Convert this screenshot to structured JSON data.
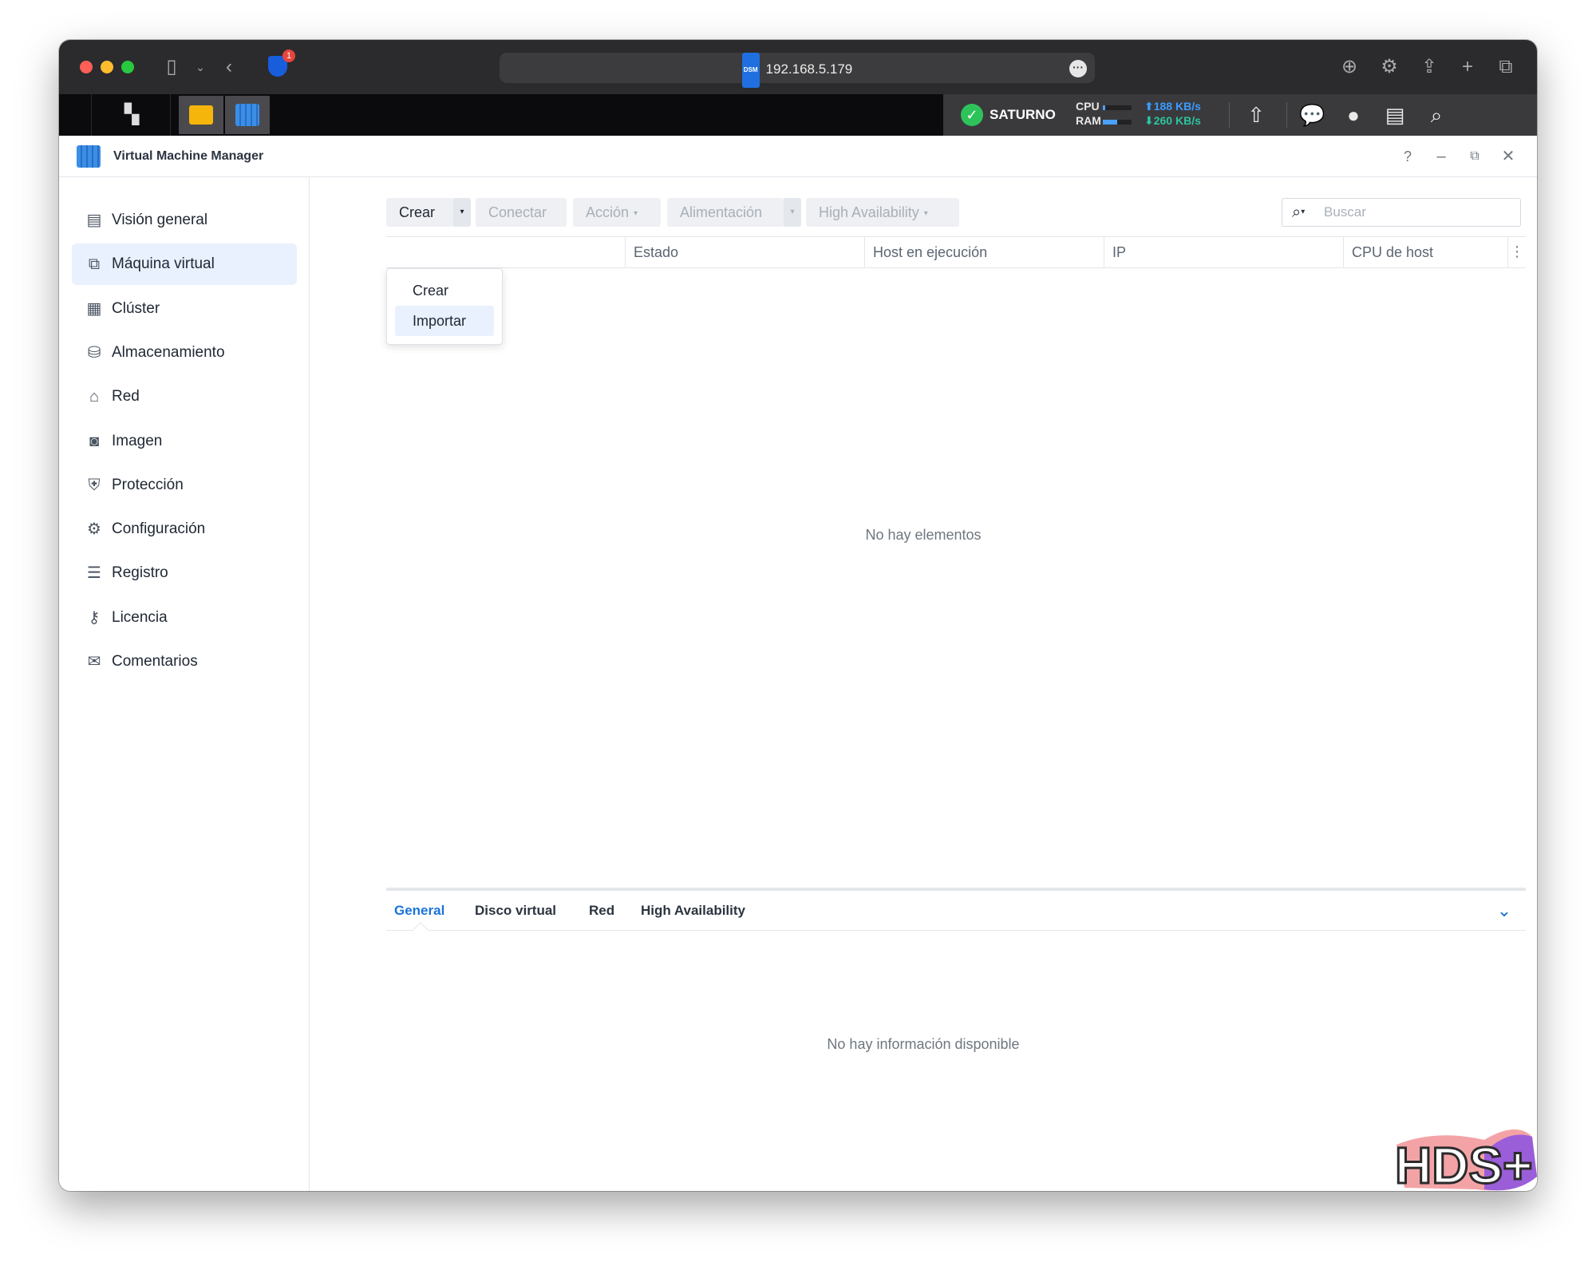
{
  "browser": {
    "url": "192.168.5.179",
    "extension_badge": "1",
    "url_badge": "DSM"
  },
  "dsm_status": {
    "server_name": "SATURNO",
    "cpu_label": "CPU",
    "ram_label": "RAM",
    "upload": "188 KB/s",
    "download": "260 KB/s",
    "cpu_level": 0.08,
    "ram_level": 0.5
  },
  "app": {
    "title": "Virtual Machine Manager",
    "help": "?"
  },
  "sidebar": {
    "items": [
      {
        "label": "Visión general",
        "icon": "overview-icon",
        "glyph": "▤"
      },
      {
        "label": "Máquina virtual",
        "icon": "virtual-machine-icon",
        "glyph": "⧉"
      },
      {
        "label": "Clúster",
        "icon": "cluster-icon",
        "glyph": "▦"
      },
      {
        "label": "Almacenamiento",
        "icon": "storage-icon",
        "glyph": "⛁"
      },
      {
        "label": "Red",
        "icon": "network-icon",
        "glyph": "⌂"
      },
      {
        "label": "Imagen",
        "icon": "image-icon",
        "glyph": "◙"
      },
      {
        "label": "Protección",
        "icon": "protection-icon",
        "glyph": "⛨"
      },
      {
        "label": "Configuración",
        "icon": "settings-icon",
        "glyph": "⚙"
      },
      {
        "label": "Registro",
        "icon": "log-icon",
        "glyph": "☰"
      },
      {
        "label": "Licencia",
        "icon": "license-key-icon",
        "glyph": "⚷"
      },
      {
        "label": "Comentarios",
        "icon": "feedback-icon",
        "glyph": "✉"
      }
    ]
  },
  "toolbar": {
    "crear": "Crear",
    "conectar": "Conectar",
    "accion": "Acción",
    "alimentacion": "Alimentación",
    "high_availability": "High Availability",
    "search_placeholder": "Buscar"
  },
  "create_menu": {
    "items": [
      "Crear",
      "Importar"
    ],
    "highlighted": "Importar"
  },
  "table": {
    "columns": [
      "",
      "Estado",
      "Host en ejecución",
      "IP",
      "CPU de host"
    ],
    "empty_text": "No hay elementos"
  },
  "details": {
    "tabs": [
      "General",
      "Disco virtual",
      "Red",
      "High Availability"
    ],
    "active_tab": "General",
    "empty_text": "No hay información disponible"
  },
  "watermark": {
    "text": "HDS+"
  },
  "colors": {
    "accent": "#1a73d9",
    "active_bg": "#e8f1fd",
    "status_ok": "#2ec35a"
  }
}
